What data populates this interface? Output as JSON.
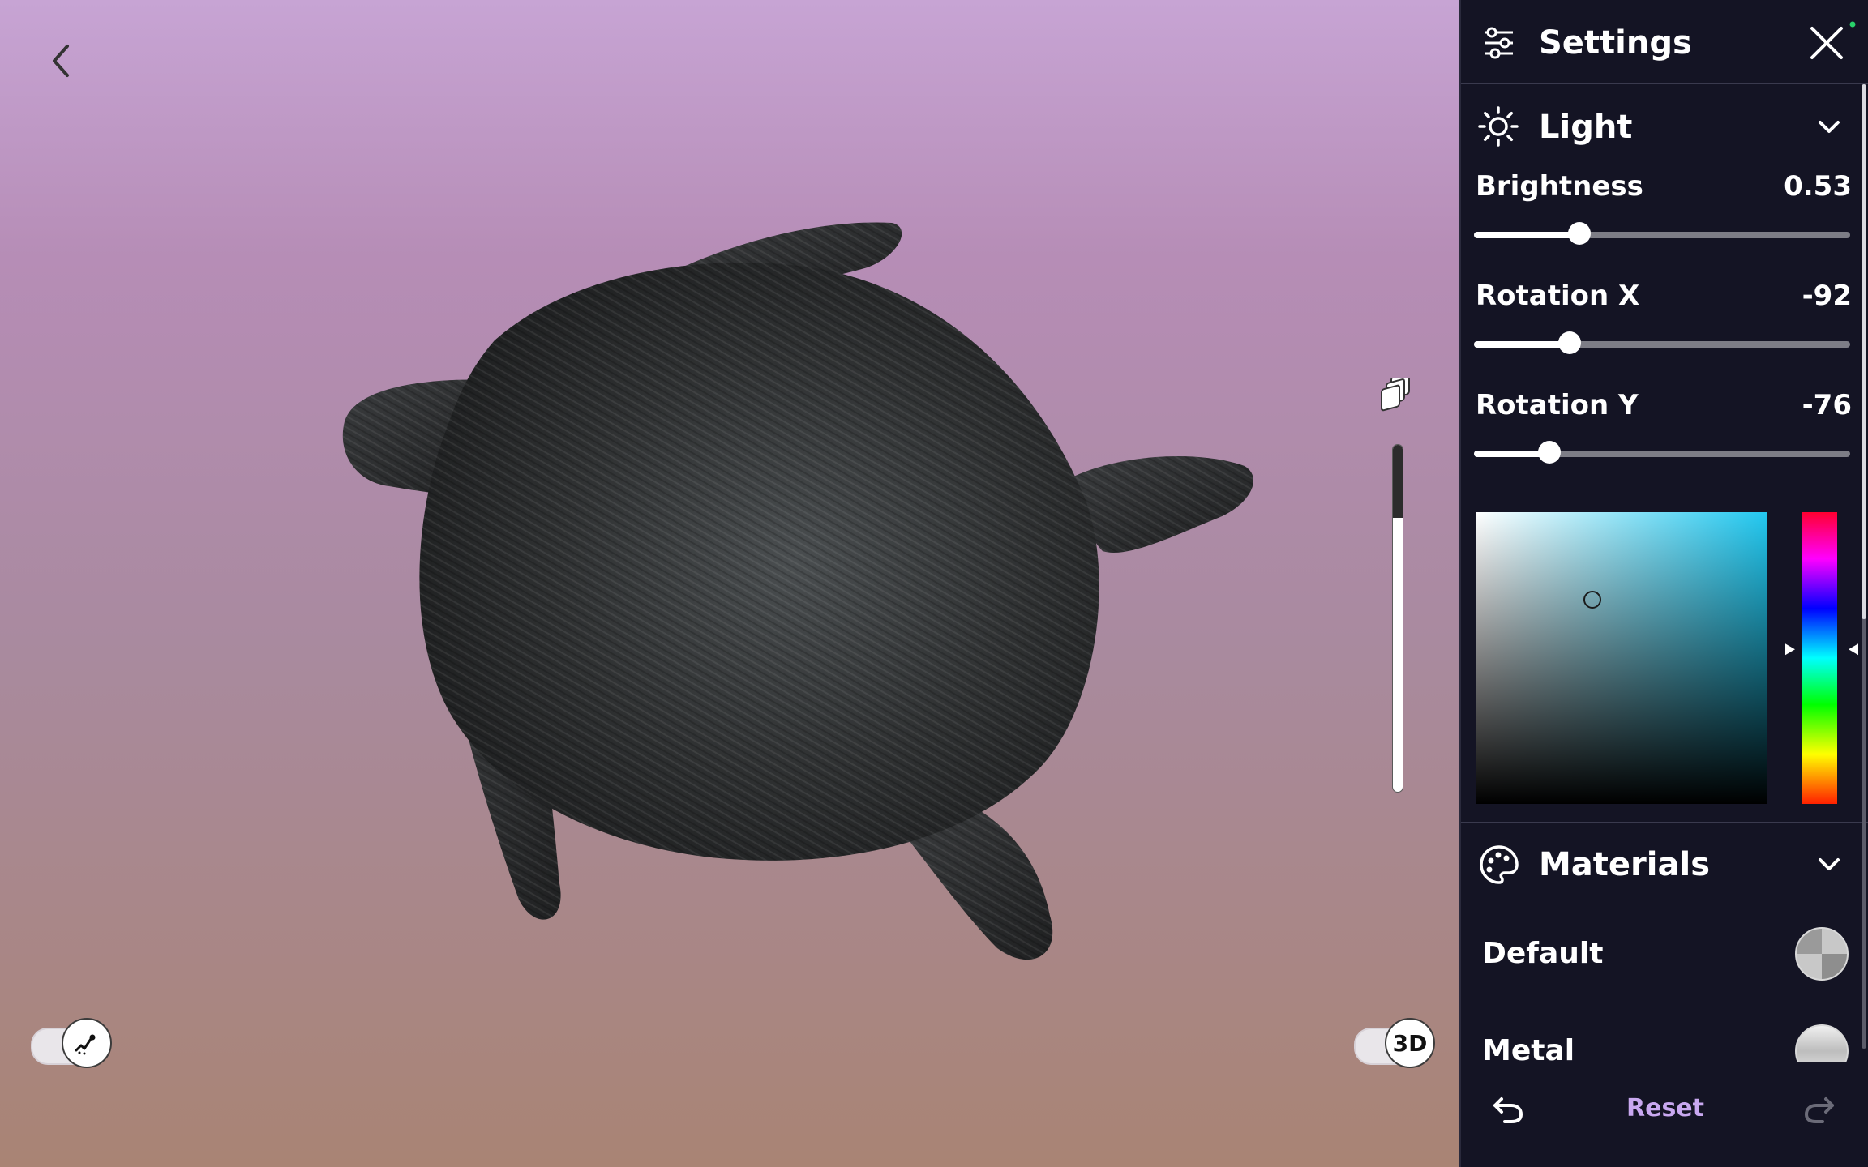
{
  "panel": {
    "title": "Settings",
    "icons": {
      "header": "sliders-icon",
      "close": "close-icon"
    },
    "light": {
      "title": "Light",
      "icon": "sun-icon",
      "sliders": [
        {
          "label": "Brightness",
          "value": "0.53",
          "fraction": 0.28
        },
        {
          "label": "Rotation X",
          "value": "-92",
          "fraction": 0.255
        },
        {
          "label": "Rotation Y",
          "value": "-76",
          "fraction": 0.2
        }
      ],
      "color": {
        "hue_hex": "#22c8f0",
        "saturation": 0.4,
        "value": 0.7,
        "hue_fraction": 0.47
      }
    },
    "materials": {
      "title": "Materials",
      "icon": "palette-icon",
      "items": [
        {
          "label": "Default"
        },
        {
          "label": "Metal"
        }
      ]
    },
    "footer": {
      "reset_label": "Reset",
      "undo_icon": "undo-icon",
      "redo_icon": "redo-icon"
    }
  },
  "viewport": {
    "back_icon": "chevron-left-icon",
    "toggle_left_icon": "scribble-icon",
    "toggle_right_label": "3D",
    "layers_icon": "layers-icon",
    "vertical_slider_fraction": 0.21
  },
  "colors": {
    "panel_bg": "#141424",
    "accent": "#c9a8f0",
    "bg_top": "#c7a4d4",
    "bg_bottom": "#a98474"
  }
}
